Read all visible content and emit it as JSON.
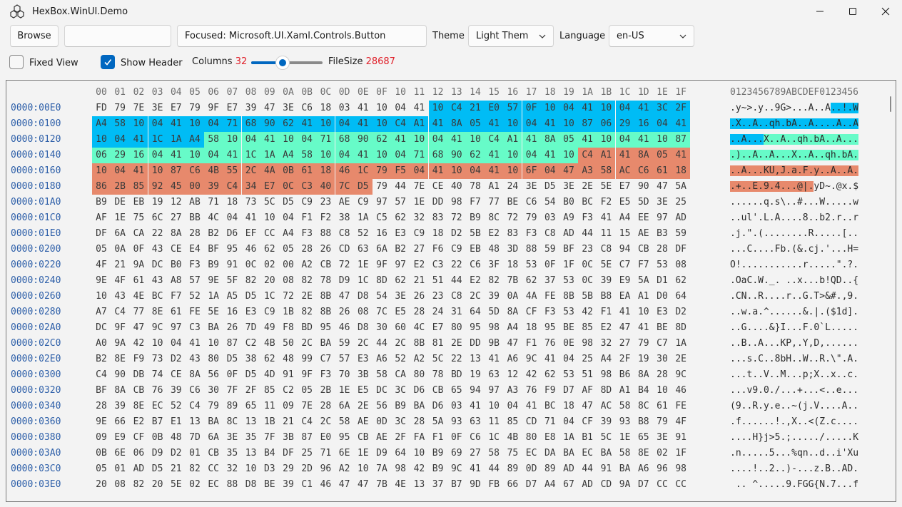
{
  "window": {
    "title": "HexBox.WinUI.Demo"
  },
  "toolbar": {
    "browse_label": "Browse",
    "path_value": "",
    "focused_value": "Focused: Microsoft.UI.Xaml.Controls.Button",
    "theme_label": "Theme",
    "theme_value": "Light Them",
    "language_label": "Language",
    "language_value": "en-US"
  },
  "options": {
    "fixed_view_label": "Fixed View",
    "fixed_view_checked": false,
    "show_header_label": "Show Header",
    "show_header_checked": true,
    "columns_label": "Columns",
    "columns_value": "32",
    "slider_fraction": 0.44,
    "filesize_label": "FileSize",
    "filesize_value": "28687"
  },
  "colors": {
    "accent": "#0067c0",
    "address": "#2c5ea8",
    "value_red": "#e0202a",
    "sel_blue": "#00bcf5",
    "sel_green": "#67fbc8",
    "sel_red": "#e7896c"
  },
  "hexview": {
    "column_headers": [
      "00",
      "01",
      "02",
      "03",
      "04",
      "05",
      "06",
      "07",
      "08",
      "09",
      "0A",
      "0B",
      "0C",
      "0D",
      "0E",
      "0F",
      "10",
      "11",
      "12",
      "13",
      "14",
      "15",
      "16",
      "17",
      "18",
      "19",
      "1A",
      "1B",
      "1C",
      "1D",
      "1E",
      "1F"
    ],
    "ascii_header": "0123456789ABCDEF0123456",
    "rows": [
      {
        "addr": "0000:00E0",
        "hex": "FD 79 7E 3E E7 79 9F E7 39 47 3E C6 18 03 41 10 04 41 10 C4 21 E0 57 0F 10 04 41 10 04 41 3C 2F",
        "ascii": ".y~>.y..9G>...A..A..!.W"
      },
      {
        "addr": "0000:0100",
        "hex": "A4 58 10 04 41 10 04 71 68 90 62 41 10 04 41 10 C4 A1 41 8A 05 41 10 04 41 10 87 06 29 16 04 41",
        "ascii": ".X..A..qh.bA..A....A..A"
      },
      {
        "addr": "0000:0120",
        "hex": "10 04 41 1C 1A A4 58 10 04 41 10 04 71 68 90 62 41 10 04 41 10 C4 A1 41 8A 05 41 10 04 41 10 87",
        "ascii": "..A...X..A..qh.bA..A..."
      },
      {
        "addr": "0000:0140",
        "hex": "06 29 16 04 41 10 04 41 1C 1A A4 58 10 04 41 10 04 71 68 90 62 41 10 04 41 10 C4 A1 41 8A 05 41",
        "ascii": ".)..A..A...X..A..qh.bA."
      },
      {
        "addr": "0000:0160",
        "hex": "10 04 41 10 87 C6 4B 55 2C 4A 0B 61 18 46 1C 79 F5 04 41 10 04 41 10 6F 04 47 A3 58 AC C6 61 18",
        "ascii": "..A...KU,J.a.F.y..A..A."
      },
      {
        "addr": "0000:0180",
        "hex": "86 2B 85 92 45 00 39 C4 34 E7 0C C3 40 7C D5 79 44 7E CE 40 78 A1 24 3E D5 3E 2E 5E E7 90 47 5A",
        "ascii": ".+..E.9.4...@|.yD~.@x.$"
      },
      {
        "addr": "0000:01A0",
        "hex": "B9 DE EB 19 12 AB 71 18 73 5C D5 C9 23 AE C9 97 57 1E DD 98 F7 77 BE C6 54 B0 BC F2 E5 5D 3E 25",
        "ascii": "......q.s\\..#...W.....w"
      },
      {
        "addr": "0000:01C0",
        "hex": "AF 1E 75 6C 27 BB 4C 04 41 10 04 F1 F2 38 1A C5 62 32 83 72 B9 8C 72 79 03 A9 F3 41 A4 EE 97 AD",
        "ascii": "..ul'.L.A....8..b2.r..r"
      },
      {
        "addr": "0000:01E0",
        "hex": "DF 6A CA 22 8A 28 B2 D6 EF CC A4 F3 88 C8 52 16 E3 C9 18 D2 5B E2 83 F3 C8 AD 44 11 15 AE B3 59",
        "ascii": ".j.\".(........R.....[.."
      },
      {
        "addr": "0000:0200",
        "hex": "05 0A 0F 43 CE E4 BF 95 46 62 05 28 26 CD 63 6A B2 27 F6 C9 EB 48 3D 88 59 BF 23 C8 94 CB 28 DF",
        "ascii": "...C....Fb.(&.cj.'...H="
      },
      {
        "addr": "0000:0220",
        "hex": "4F 21 9A DC B0 F3 B9 91 0C 02 00 A2 CB 72 1E 9F 97 E2 C3 22 C6 3F 18 53 0F 1F 0C 5E C7 F7 53 08",
        "ascii": "O!...........r.....\".?."
      },
      {
        "addr": "0000:0240",
        "hex": "9E 4F 61 43 A8 57 9E 5F 82 20 08 82 78 D9 1C 8D 62 21 51 44 E2 82 7B 62 37 53 0C 39 E9 5A D1 62",
        "ascii": ".OaC.W._. ..x...b!QD..{"
      },
      {
        "addr": "0000:0260",
        "hex": "10 43 4E BC F7 52 1A A5 D5 1C 72 2E 8B 47 D8 54 3E 26 23 C8 2C 39 0A 4A FE 8B 5B B8 EA A1 D0 64",
        "ascii": ".CN..R....r..G.T>&#.,9."
      },
      {
        "addr": "0000:0280",
        "hex": "A7 C4 77 8E 61 FE 5E 16 E3 C9 1B 82 8B 26 08 7C E5 28 24 31 64 5D 8A CF F3 53 42 F1 41 10 E3 D2",
        "ascii": "..w.a.^......&.|.($1d]."
      },
      {
        "addr": "0000:02A0",
        "hex": "DC 9F 47 9C 97 C3 BA 26 7D 49 F8 BD 95 46 D8 30 60 4C E7 80 95 98 A4 18 95 BE 85 E2 47 41 BE 8D",
        "ascii": "..G....&}I...F.0`L....."
      },
      {
        "addr": "0000:02C0",
        "hex": "A0 9A 42 10 04 41 10 87 C2 4B 50 2C BA 59 2C 44 2C 8B 81 2E DD 9B 47 F1 76 0E 98 32 27 79 C7 1A",
        "ascii": "..B..A...KP,.Y,D,......"
      },
      {
        "addr": "0000:02E0",
        "hex": "B2 8E F9 73 D2 43 80 D5 38 62 48 99 C7 57 E3 A6 52 A2 5C 22 13 41 A6 9C 41 04 25 A4 2F 19 30 2E",
        "ascii": "...s.C..8bH..W..R.\\\".A."
      },
      {
        "addr": "0000:0300",
        "hex": "C4 90 DB 74 CE 8A 56 0F D5 4D 91 9F F3 70 3B 58 CA 80 78 BD 19 63 12 42 62 53 51 98 B6 8A 28 9C",
        "ascii": "...t..V..M...p;X..x..c."
      },
      {
        "addr": "0000:0320",
        "hex": "BF 8A CB 76 39 C6 30 7F 2F 85 C2 05 2B 1E E5 DC 3C D6 CB 65 94 97 A3 76 F9 D7 AF 8D A1 B4 10 46",
        "ascii": "...v9.0./...+...<..e..."
      },
      {
        "addr": "0000:0340",
        "hex": "28 39 8E EC 52 C4 79 89 65 11 09 7E 28 6A 2E 56 B9 BA D6 03 41 10 04 41 BC 18 47 AC 58 8C 61 FE",
        "ascii": "(9..R.y.e..~(j.V....A.."
      },
      {
        "addr": "0000:0360",
        "hex": "9E 66 E2 B7 E1 13 BA 8C 13 1B 21 C4 2C 58 AE 0D 3C 28 5A 93 63 11 85 CD 71 04 CF 39 93 B8 79 4F",
        "ascii": ".f......!.,X..<(Z.c...."
      },
      {
        "addr": "0000:0380",
        "hex": "09 E9 CF 0B 48 7D 6A 3E 35 7F 3B 87 E0 95 CB AE 2F FA F1 0F C6 1C 4B 80 E8 1A B1 5C 1E 65 3E 91",
        "ascii": "....H}j>5.;...../.....K"
      },
      {
        "addr": "0000:03A0",
        "hex": "0B 6E 06 D9 D2 01 CB 35 13 B4 DF 25 71 6E 1E D9 64 10 B9 69 27 58 75 EC DA BA EC BA 58 8E 02 1F",
        "ascii": ".n.....5...%qn..d..i'Xu"
      },
      {
        "addr": "0000:03C0",
        "hex": "05 01 AD D5 21 82 CC 32 10 D3 29 2D 96 A2 10 7A 98 42 B9 9C 41 44 89 0D 89 AD 44 91 BA A6 96 98",
        "ascii": "....!..2..)-...z.B..AD."
      },
      {
        "addr": "0000:03E0",
        "hex": "20 08 82 20 5E 02 EC 88 D8 BE 39 C1 46 47 47 7B 4E 13 37 B7 9D FB 66 D7 A4 67 AD CD 9A D7 CC CC",
        "ascii": " .. ^.....9.FGG{N.7...f"
      }
    ],
    "selections": [
      {
        "color": "blue",
        "from": 18,
        "to": 69
      },
      {
        "color": "green",
        "from": 70,
        "to": 121
      },
      {
        "color": "red",
        "from": 122,
        "to": 174
      }
    ]
  }
}
